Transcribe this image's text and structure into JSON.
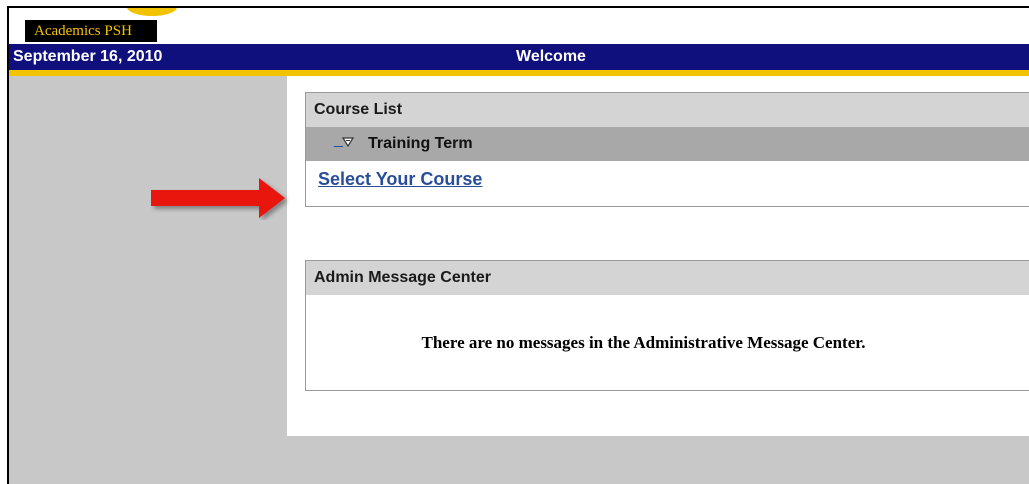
{
  "tab": {
    "label": "Academics PSH"
  },
  "header": {
    "date": "September 16, 2010",
    "title": "Welcome"
  },
  "course_list": {
    "title": "Course List",
    "term_label": "Training Term",
    "select_link": "Select Your Course"
  },
  "admin_center": {
    "title": "Admin Message Center",
    "message": "There are no messages in the Administrative Message Center."
  },
  "colors": {
    "header_bg": "#0f0f7e",
    "accent_gold": "#f2c300",
    "arrow_red": "#e8120c"
  },
  "icons": {
    "term_toggle": "collapse-triangle-icon",
    "pointer": "red-arrow-icon"
  }
}
